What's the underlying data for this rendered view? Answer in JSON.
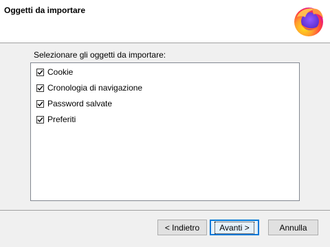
{
  "dialog": {
    "title": "Oggetti da importare",
    "logo_icon": "firefox-logo-icon"
  },
  "list": {
    "caption": "Selezionare gli oggetti da importare:",
    "items": [
      {
        "label": "Cookie",
        "checked": true
      },
      {
        "label": "Cronologia di navigazione",
        "checked": true
      },
      {
        "label": "Password salvate",
        "checked": true
      },
      {
        "label": "Preferiti",
        "checked": true
      }
    ]
  },
  "buttons": {
    "back": "< Indietro",
    "next": "Avanti >",
    "cancel": "Annulla"
  },
  "colors": {
    "accent": "#0078d7",
    "logo_orange": "#ff7139",
    "logo_purple": "#7542e5"
  }
}
